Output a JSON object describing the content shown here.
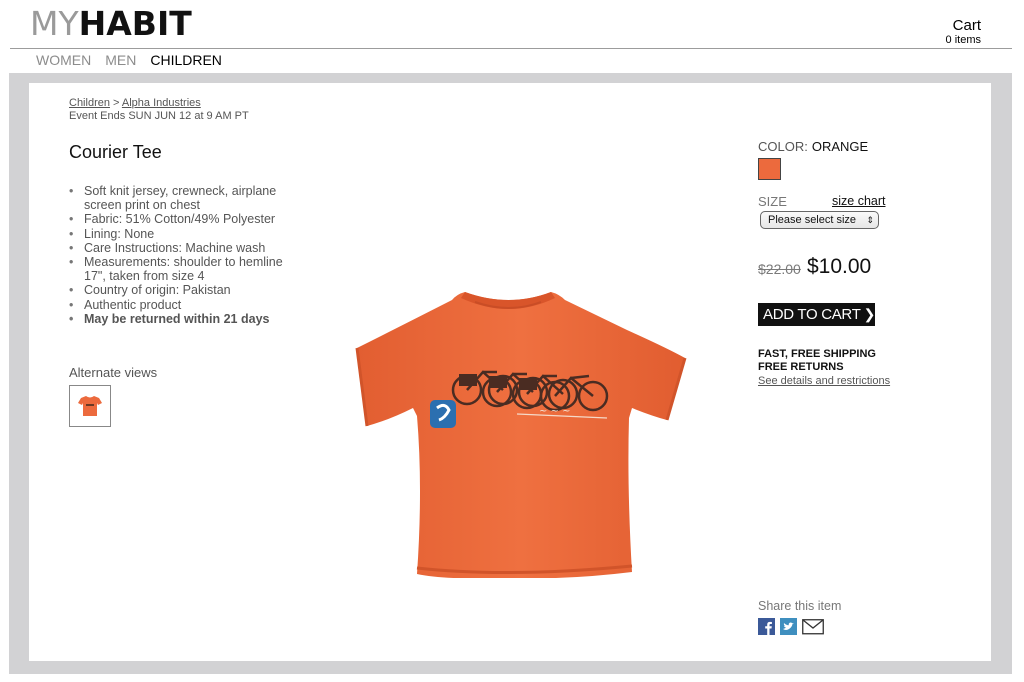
{
  "header": {
    "logo_light": "MY",
    "logo_bold": "HABIT",
    "cart_label": "Cart",
    "cart_count": "0 items"
  },
  "nav": {
    "items": [
      {
        "label": "WOMEN"
      },
      {
        "label": "MEN"
      },
      {
        "label": "CHILDREN"
      }
    ],
    "active": "CHILDREN"
  },
  "breadcrumb": {
    "category": "Children",
    "separator": " > ",
    "brand": "Alpha Industries",
    "event_ends": "Event Ends SUN JUN 12 at 9 AM PT"
  },
  "product": {
    "title": "Courier Tee",
    "features": [
      "Soft knit jersey, crewneck, airplane screen print on chest",
      "Fabric: 51% Cotton/49% Polyester",
      "Lining: None",
      "Care Instructions: Machine wash",
      "Measurements: shoulder to hemline 17\", taken from size 4",
      "Country of origin: Pakistan",
      "Authentic product",
      "May be returned within 21 days"
    ],
    "alternate_views_label": "Alternate views",
    "color_label": "COLOR:",
    "color_value": "ORANGE",
    "swatch_color": "#ec6a3d",
    "size_label": "SIZE",
    "size_chart_label": "size chart",
    "size_select_value": "Please select size",
    "price_old": "$22.00",
    "price_new": "$10.00",
    "add_to_cart_label": "ADD TO CART",
    "shipping_line1": "FAST, FREE SHIPPING",
    "shipping_line2": "FREE RETURNS",
    "shipping_link": "See details and restrictions",
    "share_label": "Share this item",
    "share_icons": [
      "facebook-icon",
      "twitter-icon",
      "email-icon"
    ]
  },
  "colors": {
    "shirt": "#ec6a3d",
    "frame_gray": "#d2d2d4",
    "facebook_blue": "#3b5998",
    "twitter_blue": "#3f8fbf"
  }
}
